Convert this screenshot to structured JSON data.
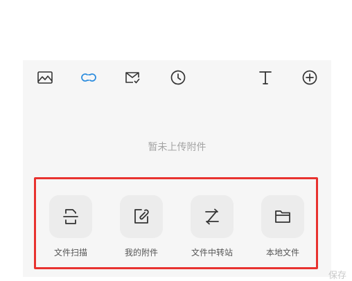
{
  "toolbar": {
    "icons": [
      "image-icon",
      "link-icon",
      "mail-check-icon",
      "clock-icon",
      "text-icon",
      "add-icon"
    ]
  },
  "attachments": {
    "empty_text": "暂未上传附件"
  },
  "options": [
    {
      "label": "文件扫描",
      "icon": "scan-icon"
    },
    {
      "label": "我的附件",
      "icon": "attachment-icon"
    },
    {
      "label": "文件中转站",
      "icon": "transfer-icon"
    },
    {
      "label": "本地文件",
      "icon": "folder-icon"
    }
  ],
  "colors": {
    "accent": "#2b8cde",
    "highlight": "#e8322f",
    "panel": "#f6f6f6",
    "icon": "#333333"
  },
  "watermark": "保存"
}
